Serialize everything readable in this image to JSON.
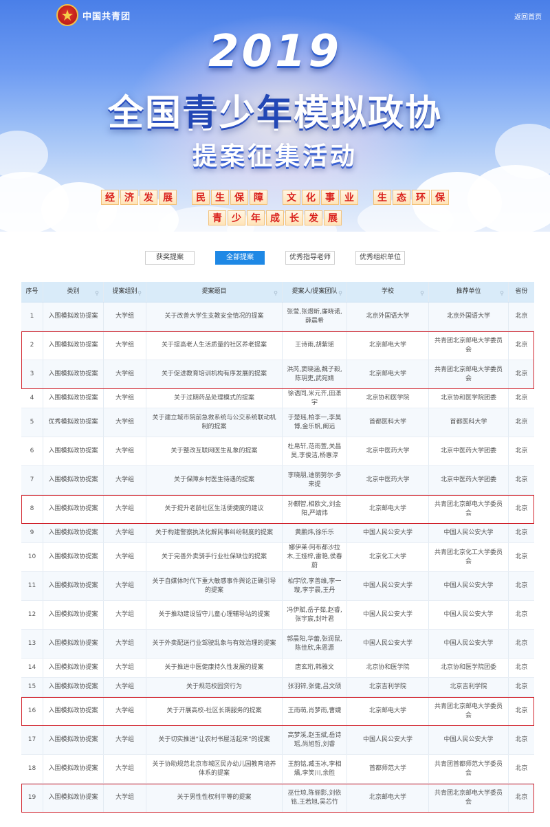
{
  "header": {
    "org_name": "中国共青团",
    "back_link": "返回首页"
  },
  "banner": {
    "year": "2019",
    "title_main": [
      "全",
      "国",
      "青",
      "少",
      "年",
      "模",
      "拟",
      "政",
      "协"
    ],
    "title_sub": "提案征集活动",
    "themes_row1": [
      "经济发展",
      "民生保障",
      "文化事业",
      "生态环保"
    ],
    "themes_row2": [
      "青少年成长发展"
    ]
  },
  "tabs": [
    {
      "label": "获奖提案",
      "active": false
    },
    {
      "label": "全部提案",
      "active": true
    },
    {
      "label": "优秀指导老师",
      "active": false
    },
    {
      "label": "优秀组织单位",
      "active": false
    }
  ],
  "table": {
    "headers": [
      "序号",
      "类别",
      "提案组别",
      "提案题目",
      "提案人/提案团队",
      "学校",
      "推荐单位",
      "省份"
    ],
    "header_icon": "search-icon",
    "rows": [
      [
        "1",
        "入围模拟政协提案",
        "大学组",
        "关于改善大学生支教安全情况的提案",
        "张莹,张煜昕,廉晓诺,薛晨希",
        "北京外国语大学",
        "北京外国语大学",
        "北京"
      ],
      [
        "2",
        "入围模拟政协提案",
        "大学组",
        "关于提高老人生活质量的社区养老提案",
        "王诗雨,胡紫瑶",
        "北京邮电大学",
        "共青团北京邮电大学委员会",
        "北京"
      ],
      [
        "3",
        "入围模拟政协提案",
        "大学组",
        "关于促进教育培训机构有序发展的提案",
        "洪芮,窦晓涵,魏子毅,陈玥吏,武宛婧",
        "北京邮电大学",
        "共青团北京邮电大学委员会",
        "北京"
      ],
      [
        "4",
        "入围模拟政协提案",
        "大学组",
        "关于过期药品处理模式的提案",
        "徐语同,米元齐,田潇宇",
        "北京协和医学院",
        "北京协和医学院团委",
        "北京"
      ],
      [
        "5",
        "优秀模拟政协提案",
        "大学组",
        "关于建立城市院前急救系统与公交系统联动机制的提案",
        "于楚瑶,柏李一,李昊博,金乐帆,阚远",
        "首都医科大学",
        "首都医科大学",
        "北京"
      ],
      [
        "6",
        "入围模拟政协提案",
        "大学组",
        "关于整改互联网医生乱象的提案",
        "杜帛轩,范雨萱,关昌昊,李俊洁,杨惠淳",
        "北京中医药大学",
        "北京中医药大学团委",
        "北京"
      ],
      [
        "7",
        "入围模拟政协提案",
        "大学组",
        "关于保障乡村医生待遇的提案",
        "李晓朋,迪丽努尔·多来提",
        "北京中医药大学",
        "北京中医药大学团委",
        "北京"
      ],
      [
        "8",
        "入围模拟政协提案",
        "大学组",
        "关于提升老龄社区生活便捷度的建议",
        "孙麒智,相欧文,刘金阳,严靖炜",
        "北京邮电大学",
        "共青团北京邮电大学委员会",
        "北京"
      ],
      [
        "9",
        "入围模拟政协提案",
        "大学组",
        "关于构建警察执法化解民事纠纷制度的提案",
        "黄鹏炜,徐乐乐",
        "中国人民公安大学",
        "中国人民公安大学",
        "北京"
      ],
      [
        "10",
        "入围模拟政协提案",
        "大学组",
        "关于完善外卖骑手行业社保缺位的提案",
        "娜伊莱·阿布都沙拉木,王娅梓,雷艳,侯春蔚",
        "北京化工大学",
        "共青团北京化工大学委员会",
        "北京"
      ],
      [
        "11",
        "入围模拟政协提案",
        "大学组",
        "关于自媒体时代下重大敏感事件舆论正确引导的提案",
        "柏宇欣,李善维,李一璇,李宇晨,王丹",
        "中国人民公安大学",
        "中国人民公安大学",
        "北京"
      ],
      [
        "12",
        "入围模拟政协提案",
        "大学组",
        "关于推动建设留守儿童心理辅导站的提案",
        "冯伊賦,岳子茹,赵睿,张宇宸,封叶君",
        "中国人民公安大学",
        "中国人民公安大学",
        "北京"
      ],
      [
        "13",
        "入围模拟政协提案",
        "大学组",
        "关于外卖配送行业驾驶乱象与有效治理的提案",
        "郭晨阳,华蕾,张润鼠,陈佳欣,朱恩源",
        "中国人民公安大学",
        "中国人民公安大学",
        "北京"
      ],
      [
        "14",
        "入围模拟政协提案",
        "大学组",
        "关于推进中医健康持久性发展的提案",
        "唐玄珩,韩雅文",
        "北京协和医学院",
        "北京协和医学院团委",
        "北京"
      ],
      [
        "15",
        "入围模拟政协提案",
        "大学组",
        "关于规范校园贷行为",
        "张羽锌,张健,吕文硕",
        "北京吉利学院",
        "北京吉利学院",
        "北京"
      ],
      [
        "16",
        "入围模拟政协提案",
        "大学组",
        "关于开展高校-社区长期服务的提案",
        "王雨萌,肖梦雨,曹婕",
        "北京邮电大学",
        "共青团北京邮电大学委员会",
        "北京"
      ],
      [
        "17",
        "入围模拟政协提案",
        "大学组",
        "关于切实推进“让农村书屋活起来”的提案",
        "高梦溪,赵玉斌,岳诗瑶,尚旭哲,刘睿",
        "中国人民公安大学",
        "中国人民公安大学",
        "北京"
      ],
      [
        "18",
        "入围模拟政协提案",
        "大学组",
        "关于协助规范北京市城区民办幼儿园教育培养体系的提案",
        "王韵铭,臧玉冰,李相燏,李笑川,余胜",
        "首都师范大学",
        "共青团首都师范大学委员会",
        "北京"
      ],
      [
        "19",
        "入围模拟政协提案",
        "大学组",
        "关于男性性权利平等的提案",
        "巫仕琼,陈俪影,刘依铭,王若旭,吴芯竹",
        "北京邮电大学",
        "共青团北京邮电大学委员会",
        "北京"
      ]
    ],
    "highlighted_rows": [
      [
        "2",
        "3"
      ],
      [
        "8"
      ],
      [
        "16"
      ],
      [
        "19"
      ]
    ],
    "highlight_color": "#d0202a"
  },
  "colors": {
    "accent": "#1e88e5",
    "header_bg": "#d9ebf9",
    "theme_text": "#d9201c"
  }
}
